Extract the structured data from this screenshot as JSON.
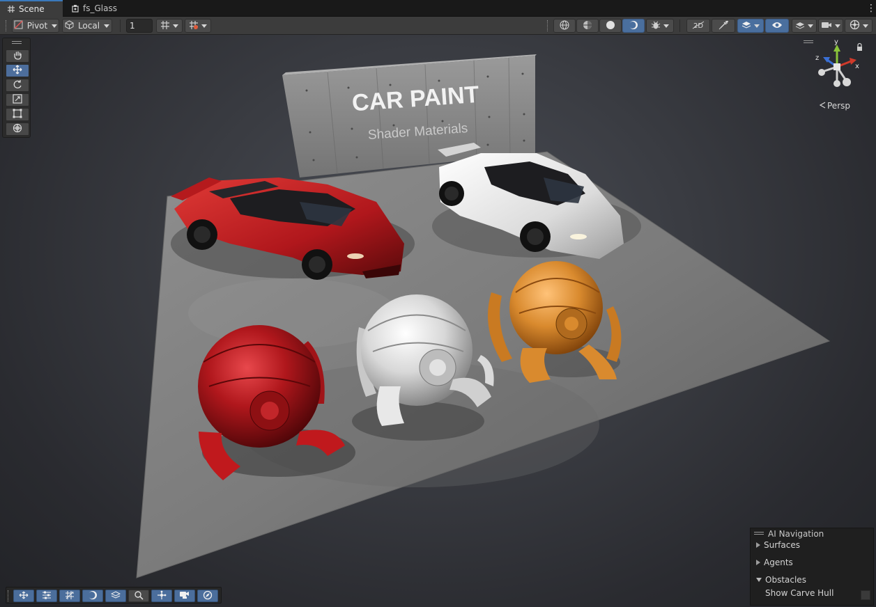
{
  "tabs": [
    {
      "label": "Scene",
      "icon": "scene-hash-icon",
      "active": true
    },
    {
      "label": "fs_Glass",
      "icon": "prefab-icon",
      "active": false
    }
  ],
  "toolbar": {
    "pivot_label": "Pivot",
    "local_label": "Local",
    "grid_snap_value": "1"
  },
  "scene": {
    "wall_title": "CAR PAINT",
    "wall_subtitle": "Shader Materials",
    "camera_mode": "Persp",
    "gizmo_axes": {
      "y": "y",
      "x": "x",
      "z": "z"
    }
  },
  "ai_navigation": {
    "title": "AI Navigation",
    "items": [
      {
        "label": "Surfaces",
        "expanded": false
      },
      {
        "label": "Agents",
        "expanded": false
      },
      {
        "label": "Obstacles",
        "expanded": true
      }
    ],
    "show_carve_hull_label": "Show Carve Hull",
    "show_carve_hull_checked": false
  },
  "colors": {
    "accent": "#4a6f9e",
    "red_paint": "#b0171c",
    "white_paint": "#e6e6e6",
    "orange_paint": "#d98a2e"
  }
}
